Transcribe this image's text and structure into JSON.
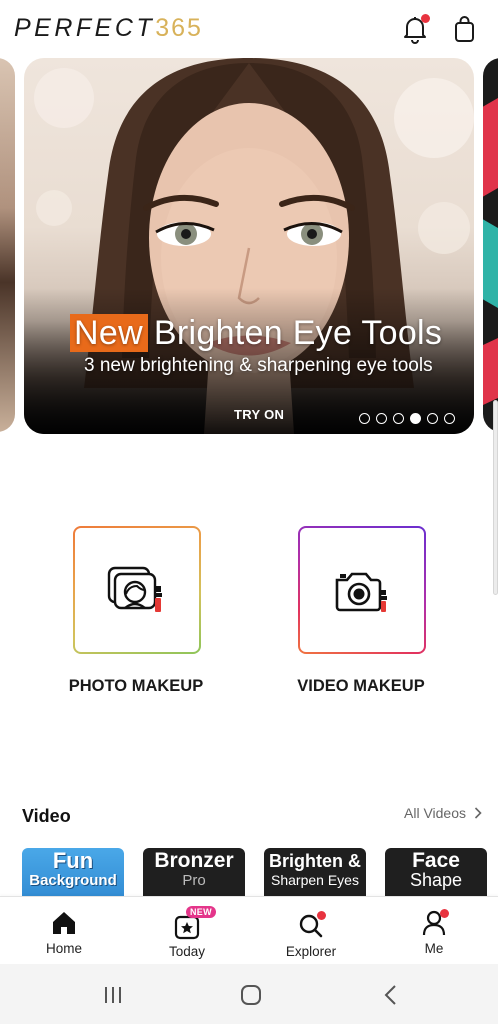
{
  "header": {
    "logo_text": "PERFECT",
    "logo_number": "365",
    "notification_icon": "bell-icon",
    "bag_icon": "shopping-bag-icon",
    "has_notification": true
  },
  "banner": {
    "highlight": "New",
    "title": "Brighten Eye Tools",
    "subtitle": "3 new brightening & sharpening eye tools",
    "cta": "TRY ON",
    "page_count": 6,
    "active_page": 4
  },
  "actions": {
    "photo_makeup": "PHOTO MAKEUP",
    "video_makeup": "VIDEO MAKEUP"
  },
  "video_section": {
    "title": "Video",
    "all_link": "All Videos",
    "thumbnails": [
      {
        "line1": "Fun",
        "line2": "Background"
      },
      {
        "line1": "Bronzer",
        "line2": "Pro"
      },
      {
        "line1": "Brighten &",
        "line2": "Sharpen Eyes"
      },
      {
        "line1": "Face",
        "line2": "Shape"
      }
    ]
  },
  "bottom_nav": {
    "home": "Home",
    "today": "Today",
    "today_badge": "NEW",
    "explorer": "Explorer",
    "me": "Me"
  },
  "colors": {
    "accent_orange": "#e86a1a",
    "logo_gold": "#d8b25a",
    "notification_red": "#e8333f",
    "new_badge": "#e4358a"
  }
}
